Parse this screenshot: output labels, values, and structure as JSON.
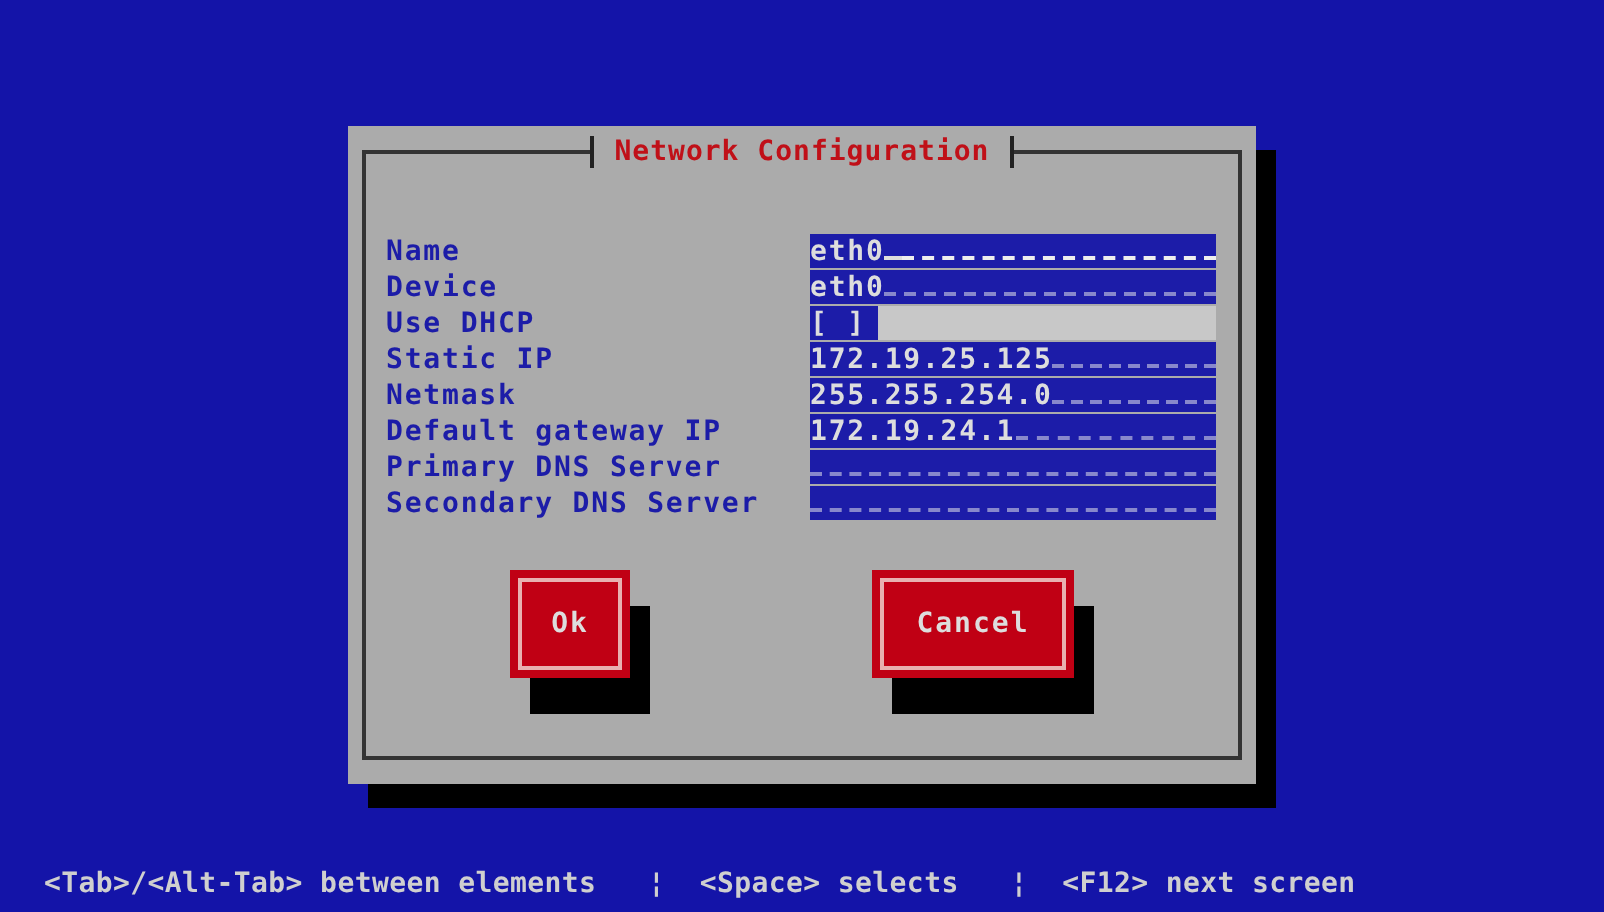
{
  "dialog": {
    "title": "Network Configuration",
    "fields": [
      {
        "kind": "text",
        "label": "Name",
        "value": "eth0",
        "focused": true
      },
      {
        "kind": "text",
        "label": "Device",
        "value": "eth0",
        "focused": false
      },
      {
        "kind": "checkbox",
        "label": "Use DHCP",
        "value": "[ ]",
        "checked": false
      },
      {
        "kind": "text",
        "label": "Static IP",
        "value": "172.19.25.125",
        "focused": false
      },
      {
        "kind": "text",
        "label": "Netmask",
        "value": "255.255.254.0",
        "focused": false
      },
      {
        "kind": "text",
        "label": "Default gateway IP",
        "value": "172.19.24.1",
        "focused": false
      },
      {
        "kind": "text",
        "label": "Primary DNS Server",
        "focused": false
      },
      {
        "kind": "text",
        "label": "Secondary DNS Server",
        "focused": false
      }
    ],
    "buttons": [
      "Ok",
      "Cancel"
    ]
  },
  "status_bar": "<Tab>/<Alt-Tab> between elements   ¦  <Space> selects   ¦  <F12> next screen"
}
